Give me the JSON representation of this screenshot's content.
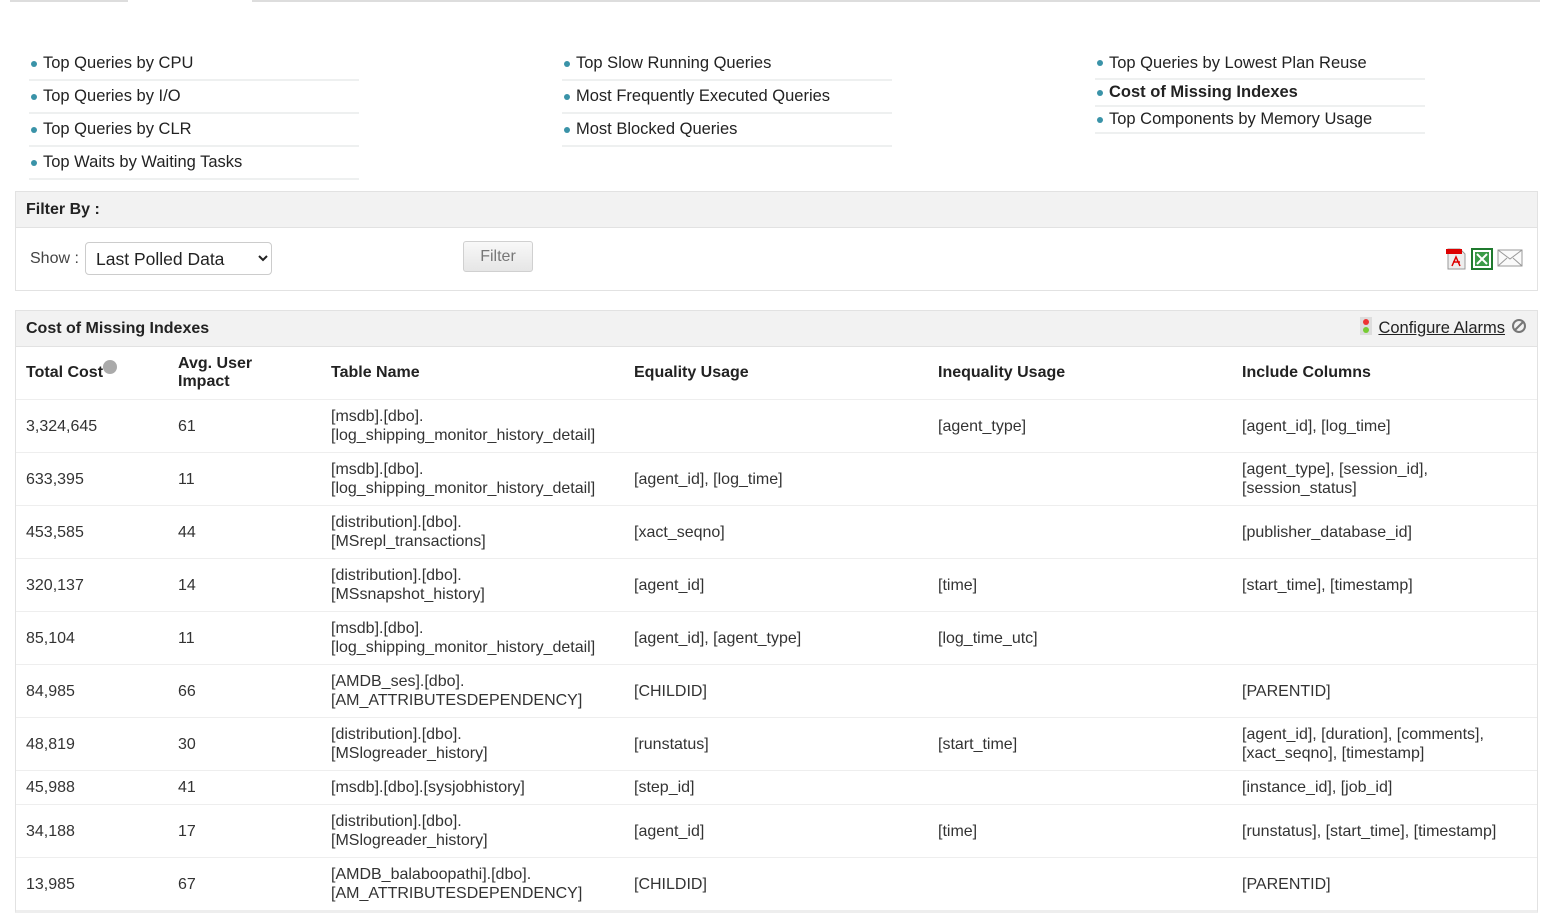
{
  "reports": {
    "col1": [
      "Top Queries by CPU",
      "Top Queries by I/O",
      "Top Queries by CLR",
      "Top Waits by Waiting Tasks"
    ],
    "col2": [
      "Top Slow Running Queries",
      "Most Frequently Executed Queries",
      "Most Blocked Queries"
    ],
    "col3": [
      "Top Queries by Lowest Plan Reuse",
      "Cost of Missing Indexes",
      "Top Components by Memory Usage"
    ]
  },
  "filter": {
    "title": "Filter By :",
    "show_label": "Show :",
    "selected": "Last Polled Data",
    "button": "Filter"
  },
  "table": {
    "title": "Cost of Missing Indexes",
    "configure": "Configure Alarms",
    "headers": [
      "Total Cost",
      "Avg. User Impact",
      "Table Name",
      "Equality Usage",
      "Inequality Usage",
      "Include Columns"
    ],
    "rows": [
      [
        "3,324,645",
        "61",
        "[msdb].[dbo].\n[log_shipping_monitor_history_detail]",
        "",
        "[agent_type]",
        "[agent_id], [log_time]"
      ],
      [
        "633,395",
        "11",
        "[msdb].[dbo].\n[log_shipping_monitor_history_detail]",
        "[agent_id], [log_time]",
        "",
        "[agent_type], [session_id],\n[session_status]"
      ],
      [
        "453,585",
        "44",
        "[distribution].[dbo].\n[MSrepl_transactions]",
        "[xact_seqno]",
        "",
        "[publisher_database_id]"
      ],
      [
        "320,137",
        "14",
        "[distribution].[dbo].\n[MSsnapshot_history]",
        "[agent_id]",
        "[time]",
        "[start_time], [timestamp]"
      ],
      [
        "85,104",
        "11",
        "[msdb].[dbo].\n[log_shipping_monitor_history_detail]",
        "[agent_id], [agent_type]",
        "[log_time_utc]",
        ""
      ],
      [
        "84,985",
        "66",
        "[AMDB_ses].[dbo].\n[AM_ATTRIBUTESDEPENDENCY]",
        "[CHILDID]",
        "",
        "[PARENTID]"
      ],
      [
        "48,819",
        "30",
        "[distribution].[dbo].\n[MSlogreader_history]",
        "[runstatus]",
        "[start_time]",
        "[agent_id], [duration], [comments],\n[xact_seqno], [timestamp]"
      ],
      [
        "45,988",
        "41",
        "[msdb].[dbo].[sysjobhistory]",
        "[step_id]",
        "",
        "[instance_id], [job_id]"
      ],
      [
        "34,188",
        "17",
        "[distribution].[dbo].\n[MSlogreader_history]",
        "[agent_id]",
        "[time]",
        "[runstatus], [start_time], [timestamp]"
      ],
      [
        "13,985",
        "67",
        "[AMDB_balaboopathi].[dbo].\n[AM_ATTRIBUTESDEPENDENCY]",
        "[CHILDID]",
        "",
        "[PARENTID]"
      ]
    ]
  }
}
